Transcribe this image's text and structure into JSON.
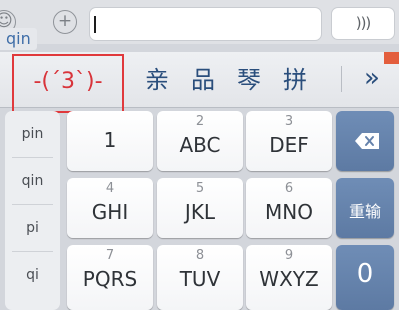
{
  "top_bar": {
    "emoji_glyph": "☺",
    "plus_glyph": "+",
    "text_field_value": "",
    "voice_label": ")))"
  },
  "composing_pinyin": "qin",
  "candidate_bar": {
    "emoticon": "-(´3`)-",
    "candidates": [
      "亲",
      "品",
      "琴",
      "拼"
    ],
    "more_label": "»"
  },
  "pinyin_options": [
    "pin",
    "qin",
    "pi",
    "qi"
  ],
  "keys": [
    {
      "num": "",
      "label": "1"
    },
    {
      "num": "2",
      "label": "ABC"
    },
    {
      "num": "3",
      "label": "DEF"
    },
    {
      "num": "4",
      "label": "GHI"
    },
    {
      "num": "5",
      "label": "JKL"
    },
    {
      "num": "6",
      "label": "MNO"
    },
    {
      "num": "7",
      "label": "PQRS"
    },
    {
      "num": "8",
      "label": "TUV"
    },
    {
      "num": "9",
      "label": "WXYZ"
    }
  ],
  "function_keys": {
    "delete_icon": "backspace-icon",
    "enter_label": "重输",
    "zero_label": "0"
  },
  "colors": {
    "function_key": "#6582ab",
    "candidate_text": "#2a4e7c",
    "highlight_border": "#e0393c",
    "pinyin_text": "#3f6ea8"
  }
}
